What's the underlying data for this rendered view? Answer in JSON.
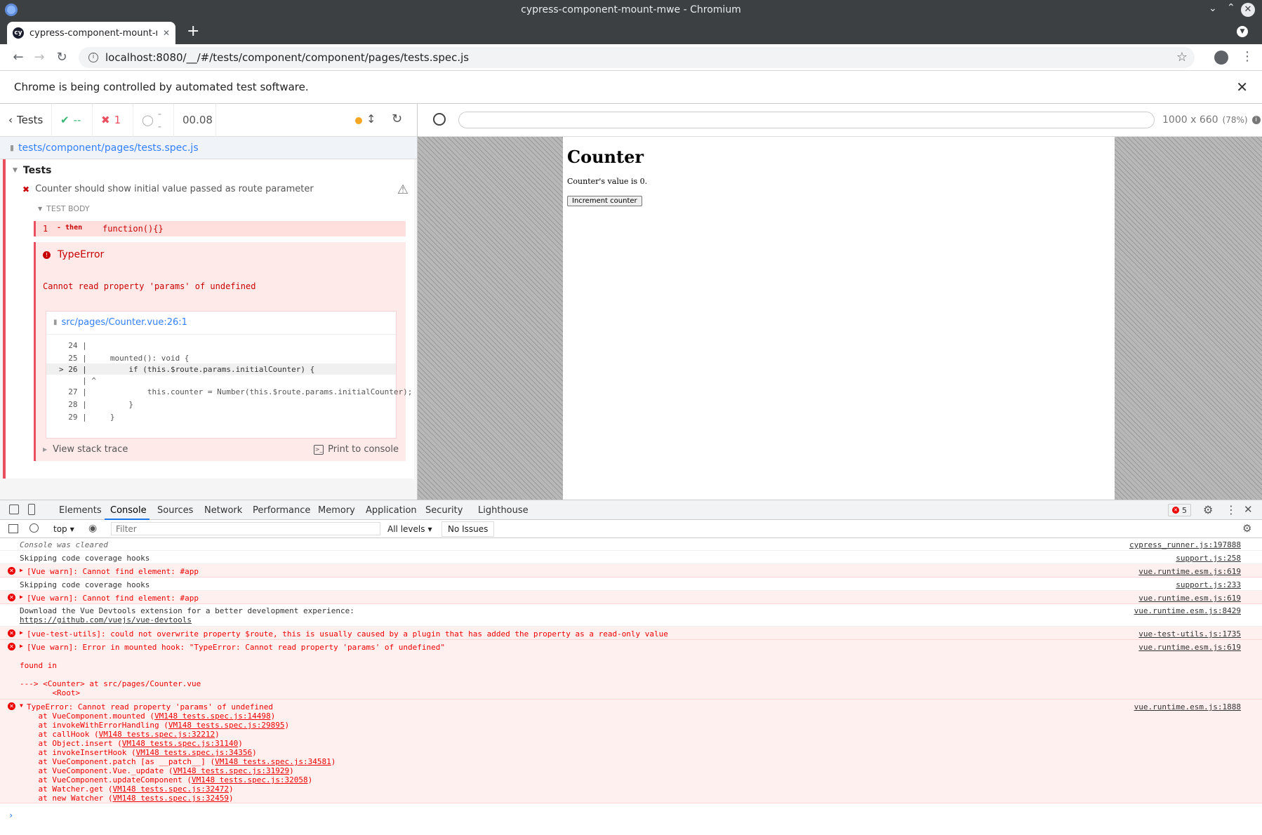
{
  "window": {
    "title": "cypress-component-mount-mwe - Chromium"
  },
  "browser": {
    "tab_title": "cypress-component-mount-m",
    "url": "localhost:8080/__/#/tests/component/component/pages/tests.spec.js",
    "infobar_message": "Chrome is being controlled by automated test software."
  },
  "reporter": {
    "back_label": "Tests",
    "passed": "--",
    "failed": "1",
    "pending": "--",
    "duration": "00.08",
    "spec_path": "tests/component/pages/tests.spec.js",
    "suite_title": "Tests",
    "test_title": "Counter should show initial value passed as route parameter",
    "test_body_label": "TEST BODY",
    "command": {
      "number": "1",
      "name": "- then",
      "message": "function(){}"
    },
    "error": {
      "name": "TypeError",
      "message": "Cannot read property 'params' of undefined",
      "file": "src/pages/Counter.vue:26:1",
      "code_lines": [
        "  24 |",
        "  25 |     mounted(): void {",
        "> 26 |         if (this.$route.params.initialCounter) {",
        "     | ^",
        "  27 |             this.counter = Number(this.$route.params.initialCounter);",
        "  28 |         }",
        "  29 |     }"
      ],
      "stack_label": "View stack trace",
      "print_label": "Print to console"
    }
  },
  "aut": {
    "viewport": "1000 x 660",
    "scale": "(78%)",
    "heading": "Counter",
    "value_text": "Counter's value is 0.",
    "button_label": "Increment counter"
  },
  "devtools": {
    "tabs": [
      "Elements",
      "Console",
      "Sources",
      "Network",
      "Performance",
      "Memory",
      "Application",
      "Security",
      "Lighthouse"
    ],
    "error_count": "5",
    "context": "top",
    "filter_placeholder": "Filter",
    "levels": "All levels",
    "issues": "No Issues",
    "console": {
      "cleared": "Console was cleared",
      "cleared_src": "cypress_runner.js:197888",
      "l1": "Skipping code coverage hooks",
      "l1_src": "support.js:258",
      "l2": "[Vue warn]: Cannot find element: #app",
      "l2_src": "vue.runtime.esm.js:619",
      "l3": "Skipping code coverage hooks",
      "l3_src": "support.js:233",
      "l4": "[Vue warn]: Cannot find element: #app",
      "l4_src": "vue.runtime.esm.js:619",
      "l5": "Download the Vue Devtools extension for a better development experience:",
      "l5_link": "https://github.com/vuejs/vue-devtools",
      "l5_src": "vue.runtime.esm.js:8429",
      "l6": "[vue-test-utils]: could not overwrite property $route, this is usually caused by a plugin that has added the property as a read-only value",
      "l6_src": "vue-test-utils.js:1735",
      "l7": "[Vue warn]: Error in mounted hook: \"TypeError: Cannot read property 'params' of undefined\"",
      "l7_found": "found in",
      "l7_c1": "---> <Counter> at src/pages/Counter.vue",
      "l7_c2": "       <Root>",
      "l7_src": "vue.runtime.esm.js:619",
      "l8": "TypeError: Cannot read property 'params' of undefined",
      "l8_src": "vue.runtime.esm.js:1888",
      "stack": [
        {
          "fn": "    at VueComponent.mounted (",
          "loc": "VM148 tests.spec.js:14498"
        },
        {
          "fn": "    at invokeWithErrorHandling (",
          "loc": "VM148 tests.spec.js:29895"
        },
        {
          "fn": "    at callHook (",
          "loc": "VM148 tests.spec.js:32212"
        },
        {
          "fn": "    at Object.insert (",
          "loc": "VM148 tests.spec.js:31140"
        },
        {
          "fn": "    at invokeInsertHook (",
          "loc": "VM148 tests.spec.js:34356"
        },
        {
          "fn": "    at VueComponent.patch [as __patch__] (",
          "loc": "VM148 tests.spec.js:34581"
        },
        {
          "fn": "    at VueComponent.Vue._update (",
          "loc": "VM148 tests.spec.js:31929"
        },
        {
          "fn": "    at VueComponent.updateComponent (",
          "loc": "VM148 tests.spec.js:32058"
        },
        {
          "fn": "    at Watcher.get (",
          "loc": "VM148 tests.spec.js:32472"
        },
        {
          "fn": "    at new Watcher (",
          "loc": "VM148 tests.spec.js:32459"
        }
      ]
    }
  }
}
